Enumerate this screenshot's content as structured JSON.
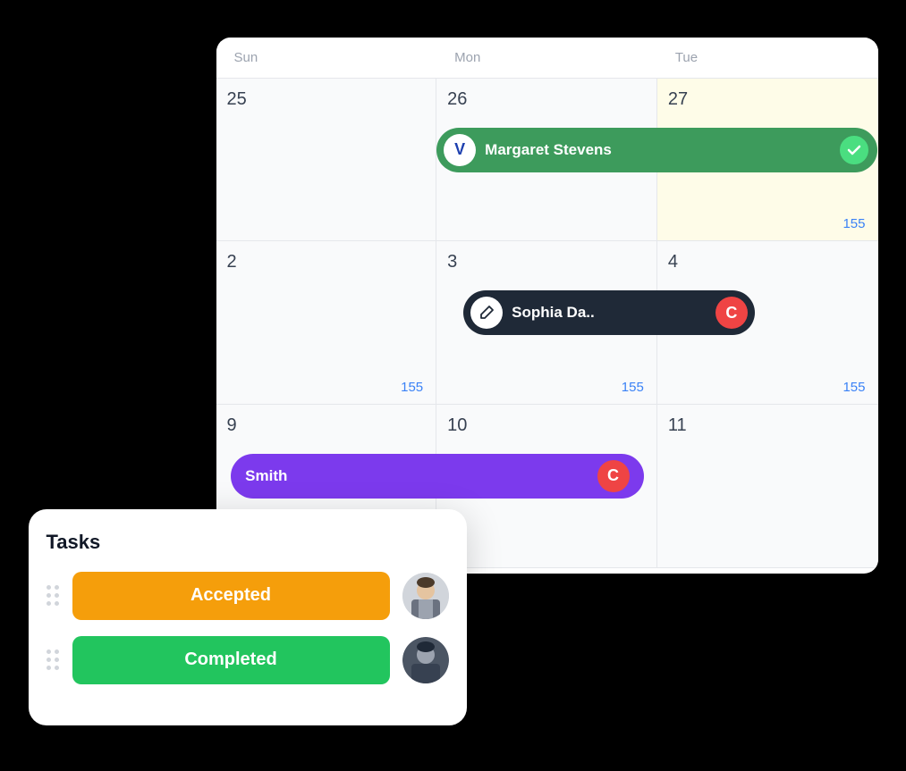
{
  "calendar": {
    "headers": [
      "Sun",
      "Mon",
      "Tue"
    ],
    "rows": [
      {
        "cells": [
          {
            "date": "25",
            "number": null,
            "today": false,
            "event": null
          },
          {
            "date": "26",
            "number": null,
            "today": false,
            "event": "margaret"
          },
          {
            "date": "27",
            "number": "155",
            "today": true,
            "event": null
          }
        ]
      },
      {
        "cells": [
          {
            "date": "2",
            "number": "155",
            "today": false,
            "event": null
          },
          {
            "date": "3",
            "number": "155",
            "today": false,
            "event": "sophia"
          },
          {
            "date": "4",
            "number": "155",
            "today": false,
            "event": null
          }
        ]
      },
      {
        "cells": [
          {
            "date": "9",
            "number": null,
            "today": false,
            "event": null
          },
          {
            "date": "10",
            "number": null,
            "today": false,
            "event": "smith"
          },
          {
            "date": "11",
            "number": null,
            "today": false,
            "event": null
          }
        ]
      }
    ],
    "events": {
      "margaret": {
        "name": "Margaret Stevens",
        "logo_letter": "V",
        "has_check": true
      },
      "sophia": {
        "name": "Sophia Da..",
        "has_pen": true,
        "has_c_badge": true
      },
      "smith": {
        "name": "Smith",
        "has_c_badge": true
      }
    }
  },
  "tasks": {
    "title": "Tasks",
    "items": [
      {
        "label": "Accepted",
        "type": "accepted"
      },
      {
        "label": "Completed",
        "type": "completed"
      }
    ]
  },
  "icons": {
    "checkmark": "✓",
    "pen": "✏",
    "c_letter": "C",
    "v_letter": "V",
    "smith_c_letter": "C"
  }
}
